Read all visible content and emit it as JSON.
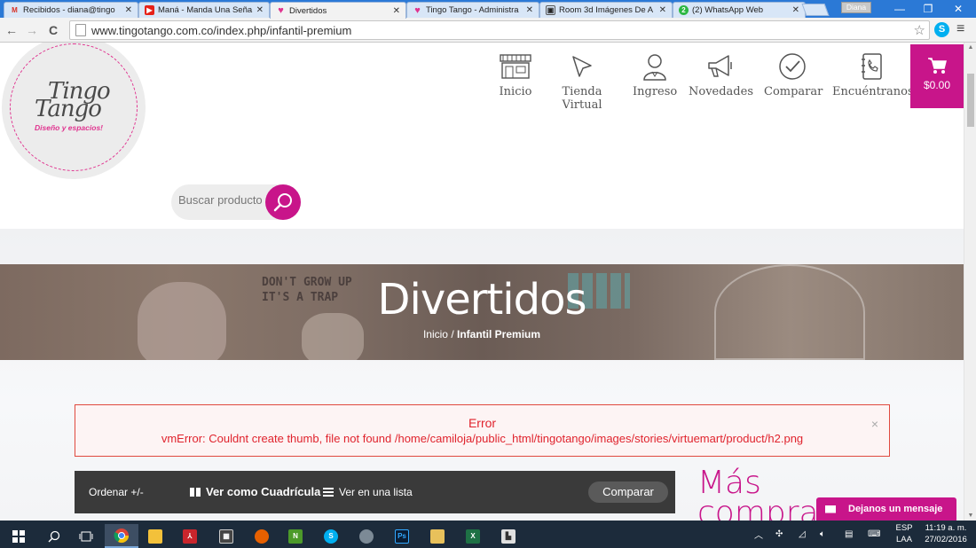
{
  "browser": {
    "tabs": [
      {
        "title": "Recibidos - diana@tingo",
        "icon": "gmail-icon",
        "active": false
      },
      {
        "title": "Maná - Manda Una Seña",
        "icon": "youtube-icon",
        "active": false
      },
      {
        "title": "Divertidos",
        "icon": "heart-icon",
        "active": true
      },
      {
        "title": "Tingo Tango - Administra",
        "icon": "heart-icon",
        "active": false
      },
      {
        "title": "Room 3d Imágenes De A",
        "icon": "image-icon",
        "active": false
      },
      {
        "title": "(2) WhatsApp Web",
        "icon": "whatsapp-icon",
        "active": false
      }
    ],
    "profile_name": "Diana",
    "url": "www.tingotango.com.co/index.php/infantil-premium"
  },
  "logo": {
    "line1": "Tingo",
    "line2": "Tango",
    "tagline": "Diseño y espacios!"
  },
  "nav": {
    "items": [
      {
        "label": "Inicio",
        "icon": "storefront-icon"
      },
      {
        "label": "Tienda Virtual",
        "icon": "cursor-icon"
      },
      {
        "label": "Ingreso",
        "icon": "user-icon"
      },
      {
        "label": "Novedades",
        "icon": "megaphone-icon"
      },
      {
        "label": "Comparar",
        "icon": "check-circle-icon"
      },
      {
        "label": "Encuéntranos",
        "icon": "contact-book-icon"
      }
    ],
    "cart_amount": "$0.00"
  },
  "search": {
    "placeholder": "Buscar producto"
  },
  "hero": {
    "title": "Divertidos",
    "breadcrumb_home": "Inicio",
    "breadcrumb_sep": "/",
    "breadcrumb_current": "Infantil Premium",
    "sign_text": "DON'T GROW UP IT'S A TRAP"
  },
  "error": {
    "title": "Error",
    "message": "vmError: Couldnt create thumb, file not found /home/camiloja/public_html/tingotango/images/stories/virtuemart/product/h2.png",
    "close": "×"
  },
  "toolbar": {
    "order_label": "Ordenar +/-",
    "grid_label": "Ver como Cuadrícula",
    "list_label": "Ver en una lista",
    "compare_label": "Comparar"
  },
  "sidebar": {
    "heading": "Más comprados"
  },
  "chat": {
    "label": "Dejanos un mensaje"
  },
  "taskbar": {
    "lang_top": "ESP",
    "lang_bottom": "LAA",
    "time": "11:19 a. m.",
    "date": "27/02/2016"
  },
  "colors": {
    "brand_pink": "#c8158a",
    "error_red": "#e0232d",
    "chrome_blue": "#2b79d6"
  }
}
